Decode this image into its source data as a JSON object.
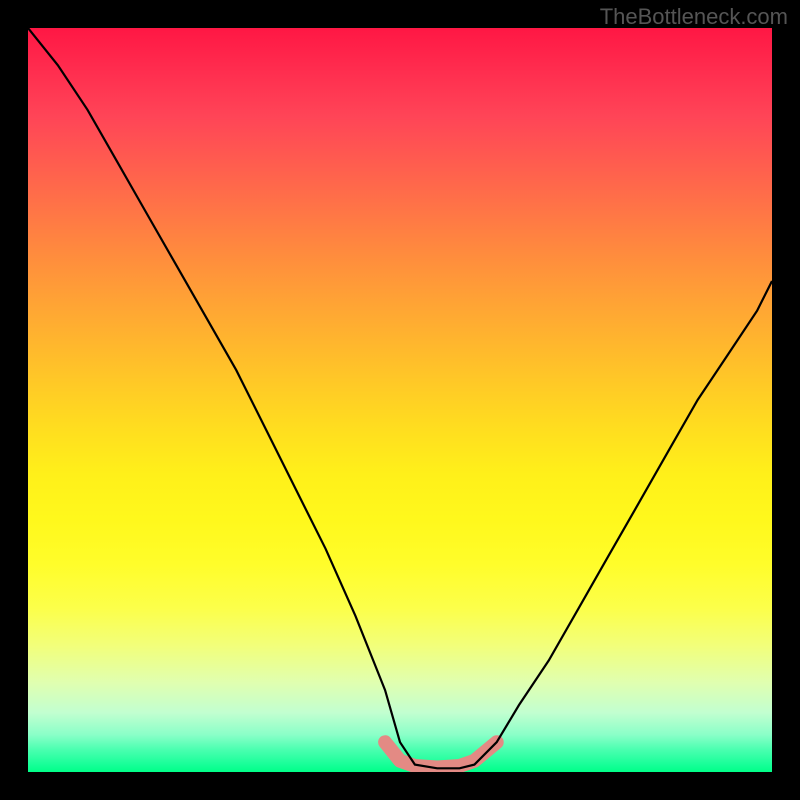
{
  "watermark": "TheBottleneck.com",
  "chart_data": {
    "type": "line",
    "title": "",
    "xlabel": "",
    "ylabel": "",
    "ylim": [
      0,
      100
    ],
    "series": [
      {
        "name": "curve",
        "x": [
          0.0,
          0.04,
          0.08,
          0.12,
          0.16,
          0.2,
          0.24,
          0.28,
          0.32,
          0.36,
          0.4,
          0.44,
          0.48,
          0.5,
          0.52,
          0.55,
          0.58,
          0.6,
          0.63,
          0.66,
          0.7,
          0.74,
          0.78,
          0.82,
          0.86,
          0.9,
          0.94,
          0.98,
          1.0
        ],
        "y": [
          100,
          95,
          89,
          82,
          75,
          68,
          61,
          54,
          46,
          38,
          30,
          21,
          11,
          4,
          1,
          0.5,
          0.5,
          1,
          4,
          9,
          15,
          22,
          29,
          36,
          43,
          50,
          56,
          62,
          66
        ]
      },
      {
        "name": "highlight-bottom",
        "x": [
          0.48,
          0.5,
          0.52,
          0.55,
          0.58,
          0.6,
          0.63
        ],
        "y": [
          4,
          1.5,
          0.8,
          0.6,
          0.8,
          1.5,
          4
        ]
      }
    ],
    "colors": {
      "curve": "#000000",
      "highlight": "#e38a84",
      "gradient_top": "#ff1744",
      "gradient_mid": "#ffde1f",
      "gradient_bottom": "#00ff88"
    },
    "annotations": []
  }
}
